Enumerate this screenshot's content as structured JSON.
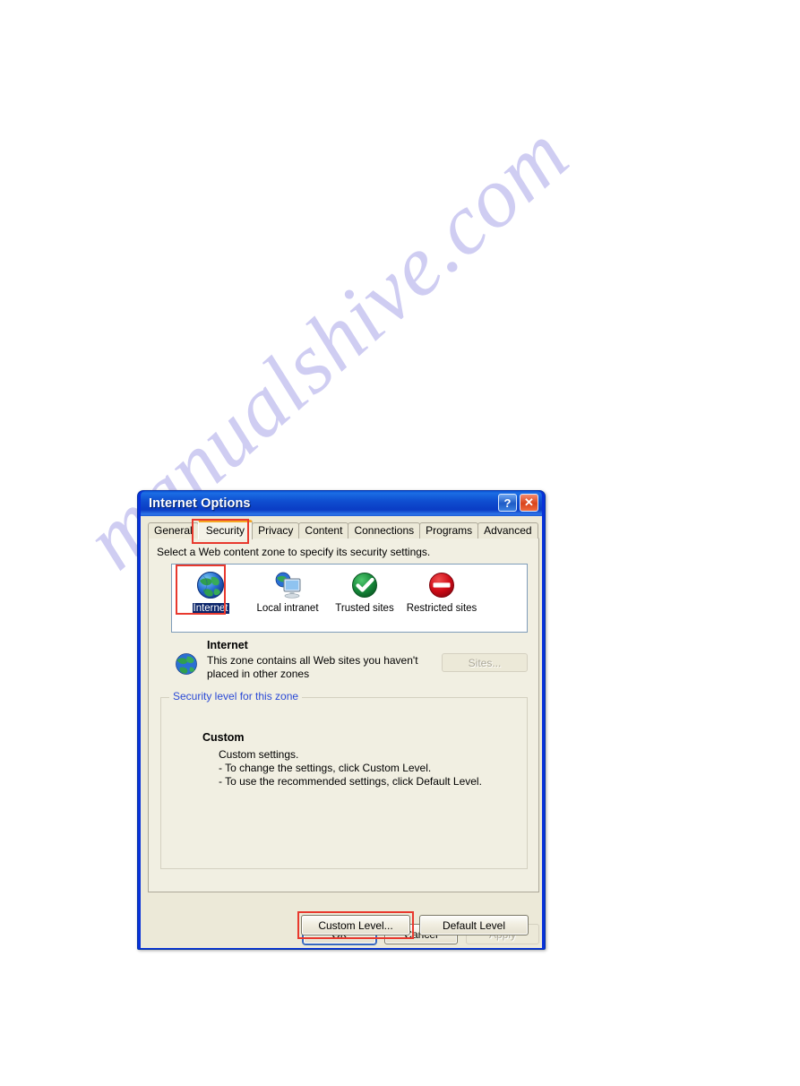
{
  "page": {
    "watermark": "manualshive.com",
    "watermark_color": "#cfcdf2",
    "background": "#ffffff"
  },
  "dialog": {
    "title": "Internet Options",
    "titlebar_buttons": [
      {
        "name": "help-button",
        "glyph": "?"
      },
      {
        "name": "close-button",
        "glyph": "✕"
      }
    ],
    "tabs": [
      {
        "label": "General",
        "active": false
      },
      {
        "label": "Security",
        "active": true
      },
      {
        "label": "Privacy",
        "active": false
      },
      {
        "label": "Content",
        "active": false
      },
      {
        "label": "Connections",
        "active": false
      },
      {
        "label": "Programs",
        "active": false
      },
      {
        "label": "Advanced",
        "active": false
      }
    ],
    "security_tab": {
      "instructions": "Select a Web content zone to specify its security settings.",
      "zones": [
        {
          "label": "Internet",
          "icon": "globe-icon",
          "selected": true
        },
        {
          "label": "Local intranet",
          "icon": "globe-monitor-icon",
          "selected": false
        },
        {
          "label": "Trusted sites",
          "icon": "green-check-icon",
          "selected": false
        },
        {
          "label": "Restricted sites",
          "icon": "red-deny-icon",
          "selected": false
        }
      ],
      "zone_description": {
        "icon": "globe-icon",
        "title": "Internet",
        "body": "This zone contains all Web sites you haven't placed in other zones"
      },
      "sites_button": {
        "label": "Sites...",
        "enabled": false
      },
      "security_level": {
        "legend": "Security level for this zone",
        "level_name": "Custom",
        "lines": [
          "Custom settings.",
          "- To change the settings, click Custom Level.",
          "- To use the recommended settings, click Default Level."
        ],
        "custom_level_button": "Custom Level...",
        "default_level_button": "Default Level"
      }
    },
    "footer_buttons": [
      {
        "label": "OK",
        "enabled": true,
        "default": true
      },
      {
        "label": "Cancel",
        "enabled": true,
        "default": false
      },
      {
        "label": "Apply",
        "enabled": false,
        "default": false
      }
    ]
  },
  "annotations": {
    "color": "#e8392e",
    "boxes": [
      {
        "target": "security-tab"
      },
      {
        "target": "internet-zone"
      },
      {
        "target": "custom-level-button"
      }
    ]
  }
}
